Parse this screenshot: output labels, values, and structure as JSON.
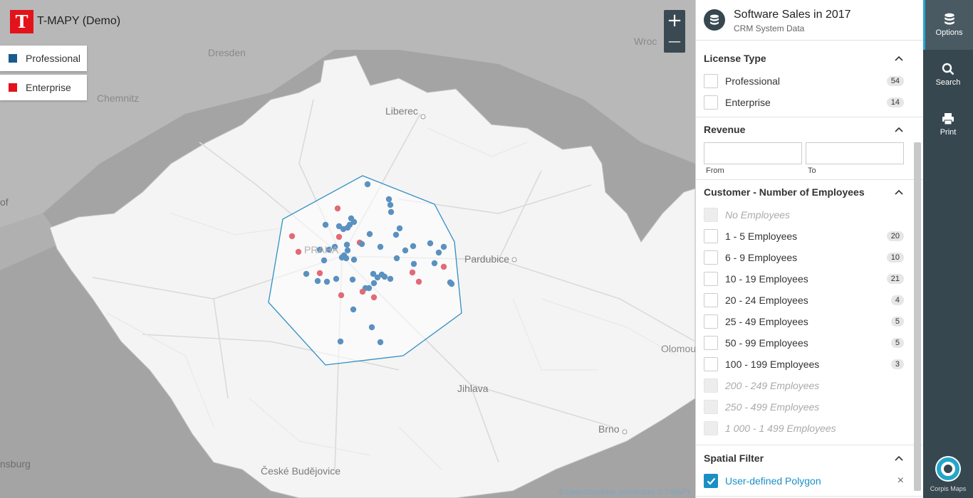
{
  "app": {
    "logo_letter": "T",
    "title": "T-MAPY (Demo)"
  },
  "legend": [
    {
      "label": "Professional",
      "color": "#1a5a8f"
    },
    {
      "label": "Enterprise",
      "color": "#e3131b"
    }
  ],
  "zoom": {
    "in_label": "+",
    "out_label": "—"
  },
  "map": {
    "cities": [
      "Dresden",
      "Chemnitz",
      "Wroc",
      "Liberec",
      "PRAHA",
      "Pardubice",
      "Jihlava",
      "Olomou",
      "Brno",
      "České Budějovice",
      "nsburg",
      "of"
    ],
    "attribution": "© OpenStreetMap contributors © T-MAPY",
    "point_colors": {
      "professional": "#5b91c0",
      "enterprise": "#e26a76"
    },
    "polygon_color": "#2f8fc4"
  },
  "panel": {
    "title": "Software Sales in 2017",
    "subtitle": "CRM System Data",
    "license": {
      "heading": "License Type",
      "items": [
        {
          "label": "Professional",
          "count": "54"
        },
        {
          "label": "Enterprise",
          "count": "14"
        }
      ]
    },
    "revenue": {
      "heading": "Revenue",
      "from_caption": "From",
      "to_caption": "To",
      "from_value": "",
      "to_value": ""
    },
    "employees": {
      "heading": "Customer - Number of Employees",
      "items": [
        {
          "label": "No Employees",
          "count": "",
          "disabled": true
        },
        {
          "label": "1 - 5 Employees",
          "count": "20",
          "disabled": false
        },
        {
          "label": "6 - 9 Employees",
          "count": "10",
          "disabled": false
        },
        {
          "label": "10 - 19 Employees",
          "count": "21",
          "disabled": false
        },
        {
          "label": "20 - 24 Employees",
          "count": "4",
          "disabled": false
        },
        {
          "label": "25 - 49 Employees",
          "count": "5",
          "disabled": false
        },
        {
          "label": "50 - 99 Employees",
          "count": "5",
          "disabled": false
        },
        {
          "label": "100 - 199 Employees",
          "count": "3",
          "disabled": false
        },
        {
          "label": "200 - 249 Employees",
          "count": "",
          "disabled": true
        },
        {
          "label": "250 - 499 Employees",
          "count": "",
          "disabled": true
        },
        {
          "label": "1 000 - 1 499 Employees",
          "count": "",
          "disabled": true
        }
      ]
    },
    "spatial": {
      "heading": "Spatial Filter",
      "item_label": "User-defined Polygon",
      "close_label": "×"
    }
  },
  "toolbar": {
    "items": [
      {
        "label": "Options",
        "icon": "database-icon"
      },
      {
        "label": "Search",
        "icon": "search-icon"
      },
      {
        "label": "Print",
        "icon": "print-icon"
      }
    ],
    "brand": "Corpis Maps"
  }
}
